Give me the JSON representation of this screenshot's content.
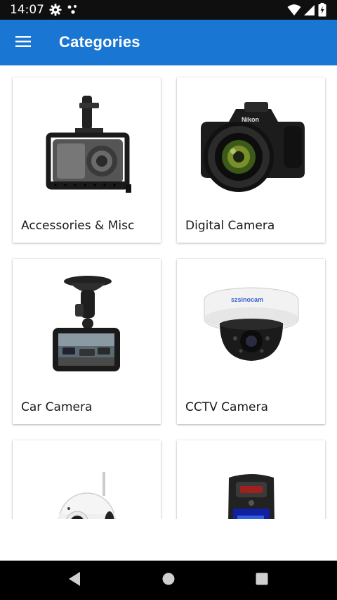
{
  "status_bar": {
    "time": "14:07",
    "icons": [
      "gear-icon",
      "dots-icon",
      "wifi-icon",
      "signal-icon",
      "battery-icon"
    ]
  },
  "app_bar": {
    "title": "Categories",
    "menu_icon": "hamburger-menu-icon",
    "background_color": "#1976d2"
  },
  "categories": [
    {
      "label": "Accessories & Misc",
      "icon": "camera-cage-image"
    },
    {
      "label": "Digital Camera",
      "icon": "digital-camera-image"
    },
    {
      "label": "Car Camera",
      "icon": "dash-camera-image"
    },
    {
      "label": "CCTV Camera",
      "icon": "dome-cctv-image",
      "brand": "szsinocam"
    },
    {
      "label": "",
      "icon": "wifi-camera-image"
    },
    {
      "label": "",
      "icon": "thermal-camera-image"
    }
  ],
  "nav_bar": {
    "buttons": [
      "back-icon",
      "home-icon",
      "recents-icon"
    ]
  }
}
